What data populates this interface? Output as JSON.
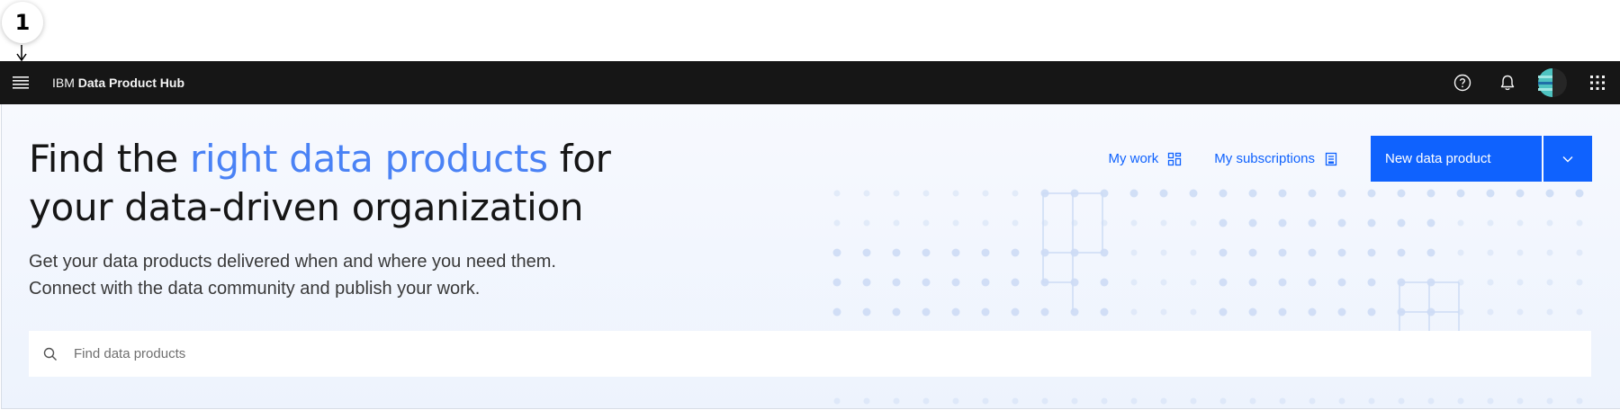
{
  "callout": {
    "number": "1"
  },
  "topbar": {
    "brand_prefix": "IBM",
    "brand_name": "Data Product Hub",
    "icons": [
      "menu-icon",
      "help-icon",
      "notification-icon",
      "avatar",
      "app-switcher-icon"
    ]
  },
  "hero": {
    "title_part1": "Find the ",
    "title_accent": "right data products",
    "title_part2": " for your data-driven organization",
    "subtitle_line1": "Get your data products delivered when and where you need them.",
    "subtitle_line2": "Connect with the data community and publish your work."
  },
  "actions": {
    "my_work": "My work",
    "my_subscriptions": "My subscriptions",
    "new_data_product": "New data product"
  },
  "search": {
    "placeholder": "Find data products",
    "value": ""
  },
  "colors": {
    "topbar_bg": "#161616",
    "primary": "#0f62fe",
    "accent_text": "#4a82f5",
    "hero_bg": "#eef3fd",
    "dot": "#cddcf5"
  }
}
